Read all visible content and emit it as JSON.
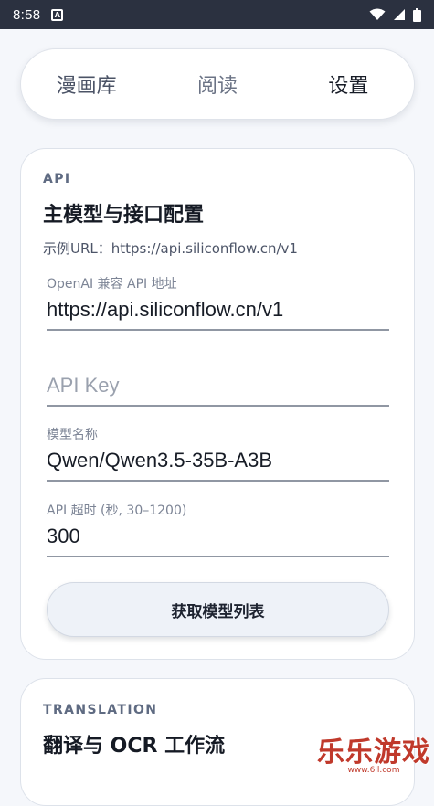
{
  "status_bar": {
    "time": "8:58",
    "notification_icon": "A",
    "icons": [
      "wifi-icon",
      "signal-icon",
      "battery-icon"
    ]
  },
  "tabs": [
    {
      "label": "漫画库",
      "active": false
    },
    {
      "label": "阅读",
      "active": false
    },
    {
      "label": "设置",
      "active": true
    }
  ],
  "api_card": {
    "eyebrow": "API",
    "title": "主模型与接口配置",
    "example": "示例URL：https://api.siliconflow.cn/v1",
    "fields": [
      {
        "label": "OpenAI 兼容 API 地址",
        "value": "https://api.siliconflow.cn/v1",
        "placeholder": ""
      },
      {
        "label": "",
        "value": "",
        "placeholder": "API Key"
      },
      {
        "label": "模型名称",
        "value": "Qwen/Qwen3.5-35B-A3B",
        "placeholder": ""
      },
      {
        "label": "API 超时 (秒, 30–1200)",
        "value": "300",
        "placeholder": ""
      }
    ],
    "button_label": "获取模型列表"
  },
  "translation_card": {
    "eyebrow": "TRANSLATION",
    "title": "翻译与 OCR 工作流"
  },
  "watermark": {
    "text": "乐乐游戏",
    "url": "www.6ll.com"
  },
  "colors": {
    "status_bar": "#2b3140",
    "background": "#f5f7fb",
    "card": "#ffffff",
    "button": "#eef2f8",
    "watermark": "#c0392b"
  }
}
